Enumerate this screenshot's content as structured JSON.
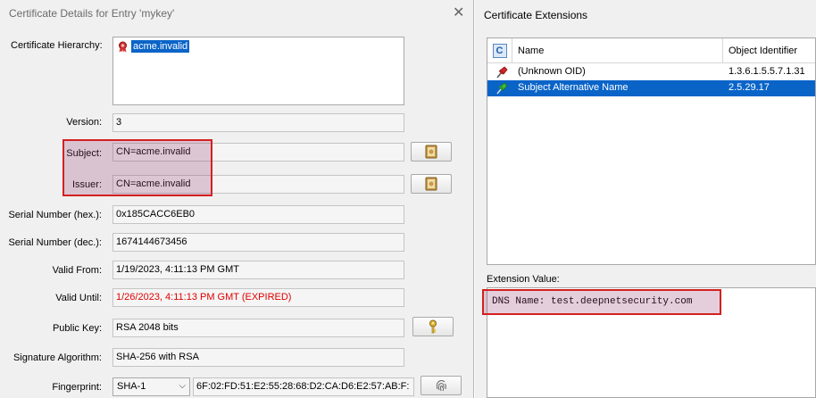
{
  "cert_dialog": {
    "title": "Certificate Details for Entry 'mykey'",
    "close_glyph": "✕",
    "hierarchy_label": "Certificate Hierarchy:",
    "hierarchy_items": [
      {
        "label": "acme.invalid",
        "icon": "certificate-ribbon-icon"
      }
    ],
    "version_label": "Version:",
    "version": "3",
    "subject_label": "Subject:",
    "subject": "CN=acme.invalid",
    "issuer_label": "Issuer:",
    "issuer": "CN=acme.invalid",
    "serial_hex_label": "Serial Number (hex.):",
    "serial_hex": "0x185CACC6EB0",
    "serial_dec_label": "Serial Number (dec.):",
    "serial_dec": "1674144673456",
    "valid_from_label": "Valid From:",
    "valid_from": "1/19/2023, 4:11:13 PM GMT",
    "valid_until_label": "Valid Until:",
    "valid_until": "1/26/2023, 4:11:13 PM GMT (EXPIRED)",
    "public_key_label": "Public Key:",
    "public_key": "RSA 2048 bits",
    "sig_alg_label": "Signature Algorithm:",
    "sig_alg": "SHA-256 with RSA",
    "fingerprint_label": "Fingerprint:",
    "fingerprint_algorithm": "SHA-1",
    "fingerprint_value": "6F:02:FD:51:E2:55:28:68:D2:CA:D6:E2:57:AB:F:",
    "expired_color": "#e00000",
    "highlight_color": "#d42020"
  },
  "extensions_dialog": {
    "title": "Certificate Extensions",
    "columns": {
      "critical": "C",
      "name": "Name",
      "oid": "Object Identifier"
    },
    "rows": [
      {
        "name": "(Unknown OID)",
        "oid": "1.3.6.1.5.5.7.1.31",
        "icon": "red-pin-icon",
        "selected": false
      },
      {
        "name": "Subject Alternative Name",
        "oid": "2.5.29.17",
        "icon": "green-pin-icon",
        "selected": true
      }
    ],
    "extension_value_label": "Extension Value:",
    "extension_value": "DNS Name: test.deepnetsecurity.com",
    "selection_color": "#0a64c8"
  }
}
